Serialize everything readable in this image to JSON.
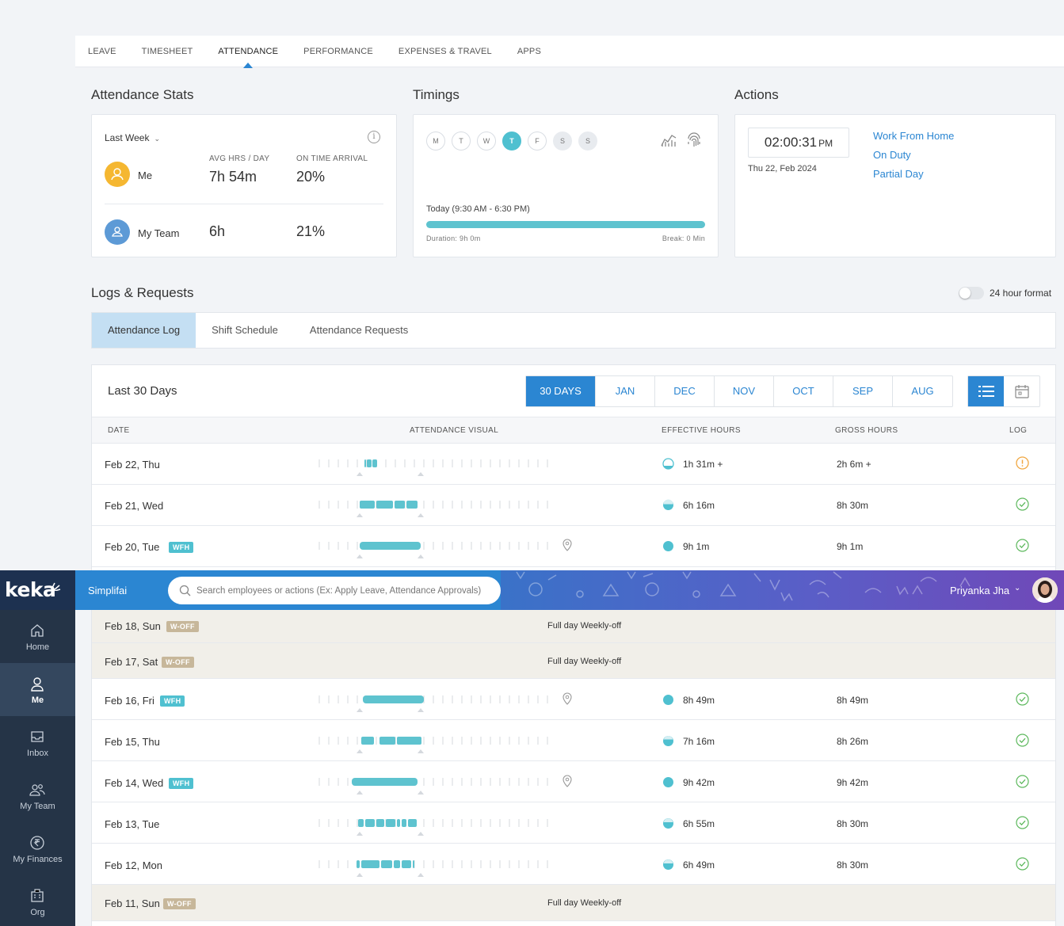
{
  "top_tabs": [
    "LEAVE",
    "TIMESHEET",
    "ATTENDANCE",
    "PERFORMANCE",
    "EXPENSES & TRAVEL",
    "APPS"
  ],
  "active_top_tab": "ATTENDANCE",
  "stats": {
    "title": "Attendance Stats",
    "period": "Last Week",
    "col1": "AVG HRS / DAY",
    "col2": "ON TIME ARRIVAL",
    "me": {
      "label": "Me",
      "avg": "7h 54m",
      "ontime": "20%",
      "color": "#f5b731"
    },
    "team": {
      "label": "My Team",
      "avg": "6h",
      "ontime": "21%",
      "color": "#5d9ad6"
    }
  },
  "timings": {
    "title": "Timings",
    "days": [
      "M",
      "T",
      "W",
      "T",
      "F",
      "S",
      "S"
    ],
    "active_day_index": 3,
    "today": "Today (9:30 AM - 6:30 PM)",
    "duration": "Duration: 9h 0m",
    "break": "Break: 0 Min"
  },
  "actions": {
    "title": "Actions",
    "time": "02:00:31",
    "ampm": "PM",
    "date": "Thu 22, Feb 2024",
    "links": [
      "Work From Home",
      "On Duty",
      "Partial Day"
    ]
  },
  "logs": {
    "title": "Logs & Requests",
    "toggle_label": "24 hour format",
    "tabs": [
      "Attendance Log",
      "Shift Schedule",
      "Attendance Requests"
    ],
    "card_title": "Last 30 Days",
    "ranges": [
      "30 DAYS",
      "JAN",
      "DEC",
      "NOV",
      "OCT",
      "SEP",
      "AUG"
    ],
    "columns": [
      "DATE",
      "ATTENDANCE VISUAL",
      "EFFECTIVE HOURS",
      "GROSS HOURS",
      "LOG"
    ],
    "rows": [
      {
        "date": "Feb 22, Thu",
        "effective": "1h 31m +",
        "gross": "2h 6m +",
        "log": "warning-icon"
      },
      {
        "date": "Feb 21, Wed",
        "effective": "6h 16m",
        "gross": "8h 30m",
        "log": "check-icon"
      },
      {
        "date": "Feb 20, Tue",
        "badge": "WFH",
        "effective": "9h 1m",
        "gross": "9h 1m",
        "log": "check-icon"
      },
      {
        "date": "Feb 18, Sun",
        "badge": "W-OFF",
        "off_text": "Full day Weekly-off"
      },
      {
        "date": "Feb 17, Sat",
        "badge": "W-OFF",
        "off_text": "Full day Weekly-off"
      },
      {
        "date": "Feb 16, Fri",
        "badge": "WFH",
        "effective": "8h 49m",
        "gross": "8h 49m",
        "log": "check-icon"
      },
      {
        "date": "Feb 15, Thu",
        "effective": "7h 16m",
        "gross": "8h 26m",
        "log": "check-icon"
      },
      {
        "date": "Feb 14, Wed",
        "badge": "WFH",
        "effective": "9h 42m",
        "gross": "9h 42m",
        "log": "check-icon"
      },
      {
        "date": "Feb 13, Tue",
        "effective": "6h 55m",
        "gross": "8h 30m",
        "log": "check-icon"
      },
      {
        "date": "Feb 12, Mon",
        "effective": "6h 49m",
        "gross": "8h 30m",
        "log": "check-icon"
      },
      {
        "date": "Feb 11, Sun",
        "badge": "W-OFF",
        "off_text": "Full day Weekly-off"
      }
    ]
  },
  "header": {
    "logo": "keka",
    "org": "Simplifai",
    "search_placeholder": "Search employees or actions (Ex: Apply Leave, Attendance Approvals)",
    "user": "Priyanka Jha"
  },
  "sidebar": {
    "items": [
      {
        "label": "Home",
        "icon": "home-icon"
      },
      {
        "label": "Me",
        "icon": "person-icon"
      },
      {
        "label": "Inbox",
        "icon": "inbox-icon"
      },
      {
        "label": "My Team",
        "icon": "team-icon"
      },
      {
        "label": "My Finances",
        "icon": "rupee-icon"
      },
      {
        "label": "Org",
        "icon": "org-icon"
      }
    ],
    "active": "Me"
  }
}
